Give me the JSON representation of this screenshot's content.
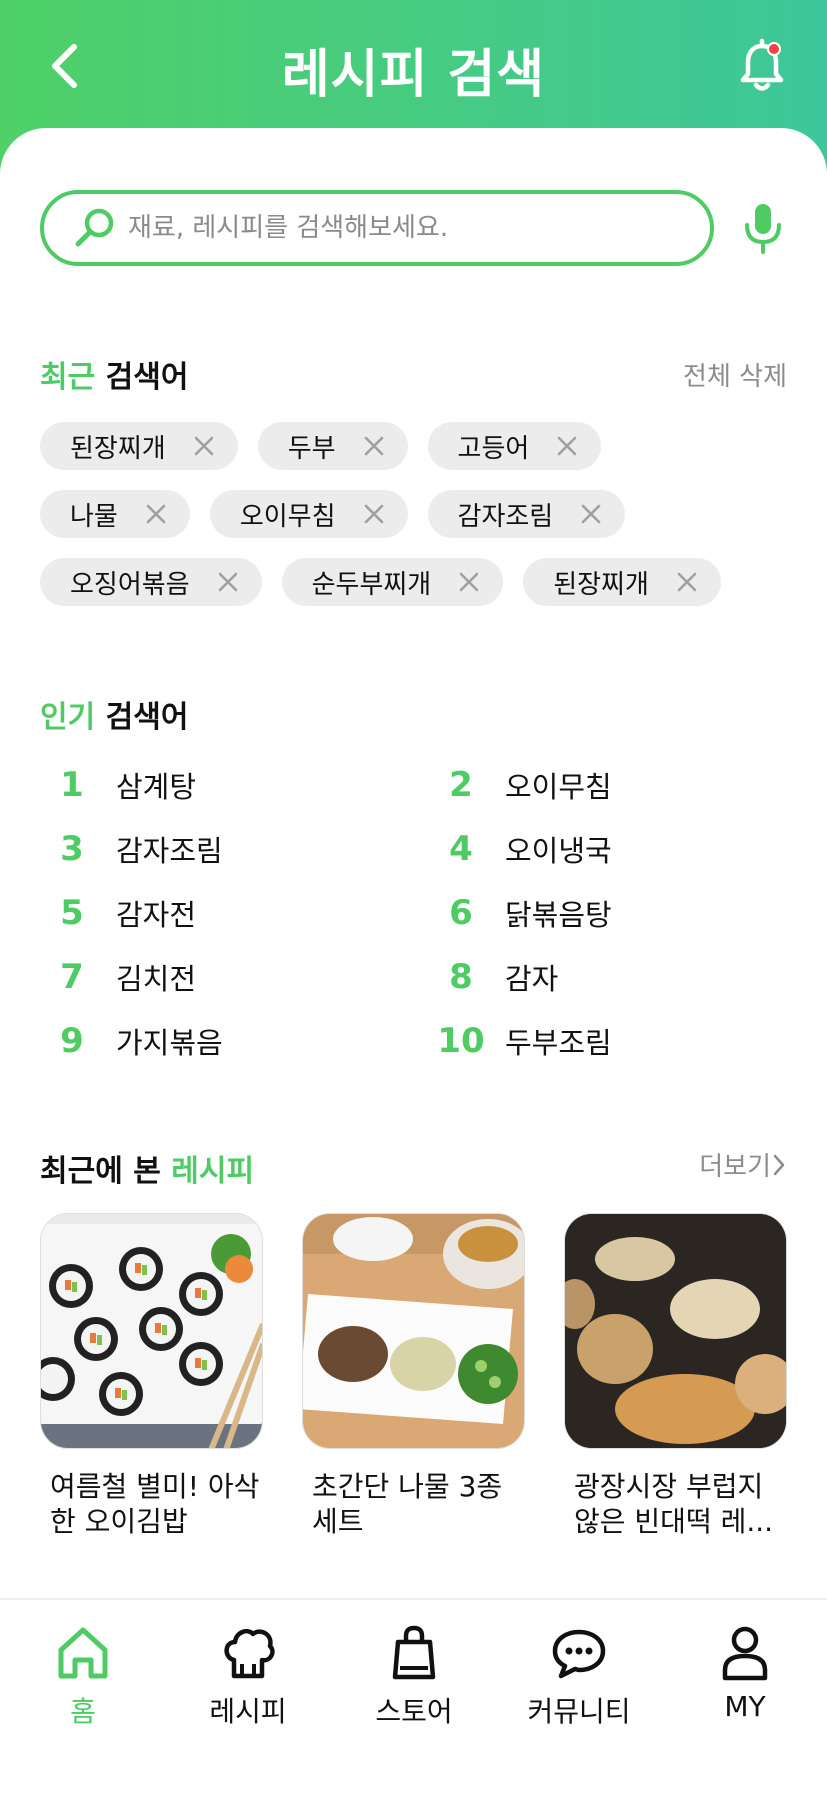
{
  "header": {
    "title": "레시피 검색",
    "back_icon": "chevron-left-icon",
    "bell_icon": "bell-icon",
    "notification_dot_color": "#ef4444"
  },
  "search": {
    "placeholder": "재료, 레시피를 검색해보세요.",
    "value": ""
  },
  "recent": {
    "title_accent": "최근",
    "title_rest": " 검색어",
    "clear_all": "전체 삭제",
    "rows": [
      [
        "된장찌개",
        "두부",
        "고등어"
      ],
      [
        "나물",
        "오이무침",
        "감자조림"
      ],
      [
        "오징어볶음",
        "순두부찌개",
        "된장찌개"
      ]
    ]
  },
  "popular": {
    "title_accent": "인기",
    "title_rest": " 검색어",
    "items": [
      {
        "rank": "1",
        "label": "삼계탕"
      },
      {
        "rank": "2",
        "label": "오이무침"
      },
      {
        "rank": "3",
        "label": "감자조림"
      },
      {
        "rank": "4",
        "label": "오이냉국"
      },
      {
        "rank": "5",
        "label": "감자전"
      },
      {
        "rank": "6",
        "label": "닭볶음탕"
      },
      {
        "rank": "7",
        "label": "김치전"
      },
      {
        "rank": "8",
        "label": "감자"
      },
      {
        "rank": "9",
        "label": "가지볶음"
      },
      {
        "rank": "10",
        "label": "두부조림"
      }
    ]
  },
  "viewed": {
    "title_rest": "최근에 본 ",
    "title_accent": "레시피",
    "more": "더보기",
    "items": [
      {
        "title": "여름철 별미! 아삭한 오이김밥"
      },
      {
        "title": "초간단 나물 3종 세트"
      },
      {
        "title": "광장시장 부럽지 않은 빈대떡 레..."
      }
    ]
  },
  "nav": [
    {
      "label": "홈",
      "icon": "home-icon",
      "active": true
    },
    {
      "label": "레시피",
      "icon": "chef-hat-icon",
      "active": false
    },
    {
      "label": "스토어",
      "icon": "shopping-bag-icon",
      "active": false
    },
    {
      "label": "커뮤니티",
      "icon": "chat-bubble-icon",
      "active": false
    },
    {
      "label": "MY",
      "icon": "user-icon",
      "active": false
    }
  ],
  "colors": {
    "accent": "#4fcb64",
    "chip_bg": "#ececec",
    "muted": "#8c8c8c"
  }
}
